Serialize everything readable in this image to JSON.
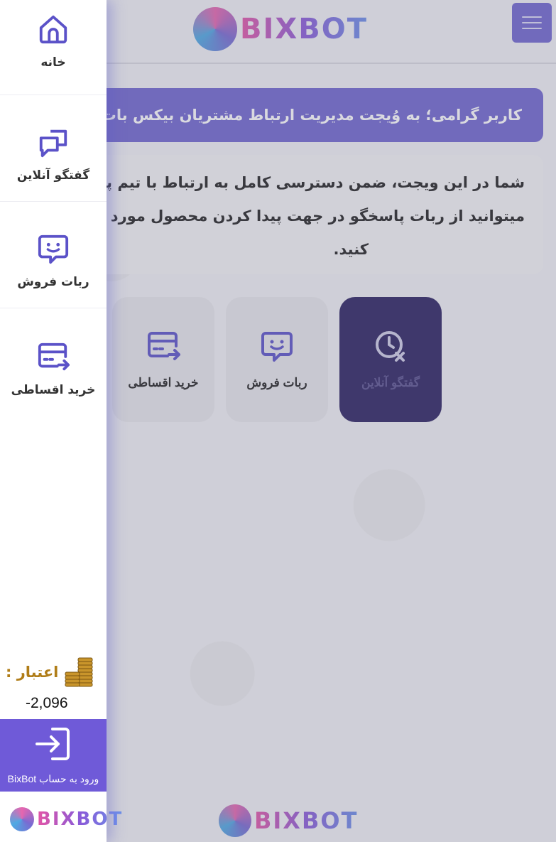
{
  "app": {
    "brand": "BIXBOT"
  },
  "header": {
    "menu_icon": "hamburger-icon"
  },
  "main": {
    "welcome": "کاربر گرامی؛ به وُیجت مدیریت ارتباط مشتریان بیکس بات خوش",
    "intro_lines": [
      "شما در این ویجت، ضمن دسترسی کامل به ارتباط با تیم پشتیبانی",
      "میتوانید از ربات پاسخگو در جهت پیدا کردن محصول مورد نظر خ",
      "کنید."
    ],
    "cards": [
      {
        "label": "گفتگو آنلاین",
        "icon": "clock-cancel-icon"
      },
      {
        "label": "ربات فروش",
        "icon": "bot-chat-icon"
      },
      {
        "label": "خرید اقساطی",
        "icon": "card-transfer-icon"
      }
    ]
  },
  "sidebar": {
    "items": [
      {
        "label": "خانه",
        "icon": "home-icon"
      },
      {
        "label": "گفتگو آنلاین",
        "icon": "chat-icon"
      },
      {
        "label": "ربات فروش",
        "icon": "bot-chat-icon"
      },
      {
        "label": "خرید اقساطی",
        "icon": "card-transfer-icon"
      }
    ],
    "credit_label": "اعتبار :",
    "credit_value": "-2,096",
    "login_label": "ورود به حساب BixBot"
  },
  "colors": {
    "accent": "#6f66cf",
    "login_bg": "#6f5ad8",
    "credit_title": "#b07d18"
  }
}
